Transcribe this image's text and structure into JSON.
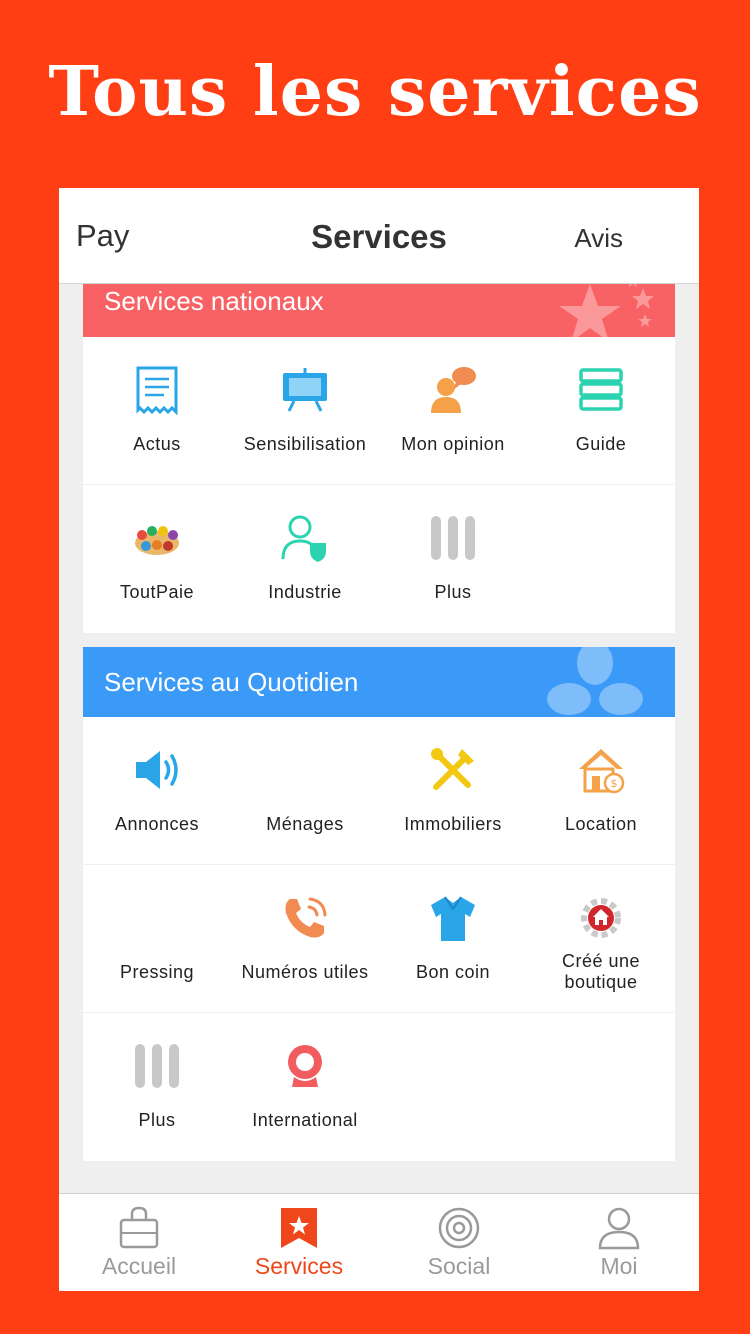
{
  "promo": {
    "title": "Tous les services"
  },
  "navbar": {
    "left": "Pay",
    "title": "Services",
    "right": "Avis"
  },
  "sections": {
    "national": {
      "title": "Services nationaux",
      "color": "#f96265",
      "items": [
        "Actus",
        "Sensibilisation",
        "Mon opinion",
        "Guide",
        "ToutPaie",
        "Industrie",
        "Plus"
      ]
    },
    "daily": {
      "title": "Services au Quotidien",
      "color": "#3b99f7",
      "items": [
        "Annonces",
        "Ménages",
        "Immobiliers",
        "Location",
        "Pressing",
        "Numéros utiles",
        "Bon coin",
        "Créé une boutique",
        "Plus",
        "International"
      ]
    }
  },
  "tabbar": {
    "tabs": [
      "Accueil",
      "Services",
      "Social",
      "Moi"
    ],
    "active": 1,
    "active_color": "#f0461c",
    "inactive_color": "#9a9a9a"
  },
  "icons": {
    "national": [
      "document-icon",
      "presentation-board-icon",
      "speech-person-icon",
      "stack-icon",
      "crowd-icon",
      "person-shield-icon",
      "more-bars-icon"
    ],
    "daily": [
      "speaker-icon",
      "",
      "tools-icon",
      "house-money-icon",
      "",
      "phone-ring-icon",
      "tshirt-icon",
      "shop-gear-icon",
      "more-bars-icon",
      "globe-pin-icon"
    ],
    "tabs": [
      "bag-icon",
      "bookmark-star-icon",
      "target-icon",
      "user-icon"
    ]
  }
}
